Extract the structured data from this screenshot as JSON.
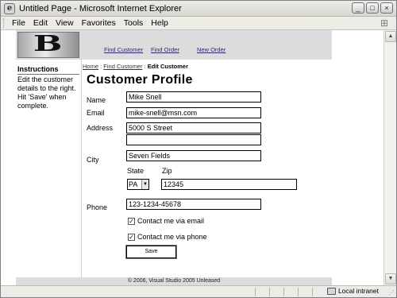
{
  "window": {
    "title": "Untitled Page - Microsoft Internet Explorer",
    "app_icon": "ie-icon"
  },
  "window_buttons": {
    "minimize": "_",
    "maximize": "□",
    "close": "×"
  },
  "menu": {
    "items": [
      "File",
      "Edit",
      "View",
      "Favorites",
      "Tools",
      "Help"
    ]
  },
  "banner": {
    "logo_letter": "B",
    "nav": [
      "Find Customer",
      "Find Order",
      "New Order"
    ]
  },
  "breadcrumb": {
    "home": "Home",
    "sep": ":",
    "find": "Find Customer",
    "current": "Edit Customer"
  },
  "sidebar": {
    "title": "Instructions",
    "text": "Edit the customer details to the right. Hit 'Save' when complete."
  },
  "form": {
    "title": "Customer Profile",
    "name_label": "Name",
    "name_value": "Mike Snell",
    "email_label": "Email",
    "email_value": "mike-snell@msn.com",
    "address_label": "Address",
    "address1_value": "5000 S Street",
    "address2_value": "",
    "city_label": "City",
    "city_value": "Seven Fields",
    "state_label": "State",
    "state_value": "PA",
    "zip_label": "Zip",
    "zip_value": "12345",
    "phone_label": "Phone",
    "phone_value": "123-1234-45678",
    "contact_email_label": "Contact me via email",
    "contact_email_checked": true,
    "contact_phone_label": "Contact me via phone",
    "contact_phone_checked": true,
    "save_label": "Save"
  },
  "footer": {
    "text": "© 2006, Visual Studio 2005 Unleased"
  },
  "status": {
    "zone": "Local intranet"
  }
}
